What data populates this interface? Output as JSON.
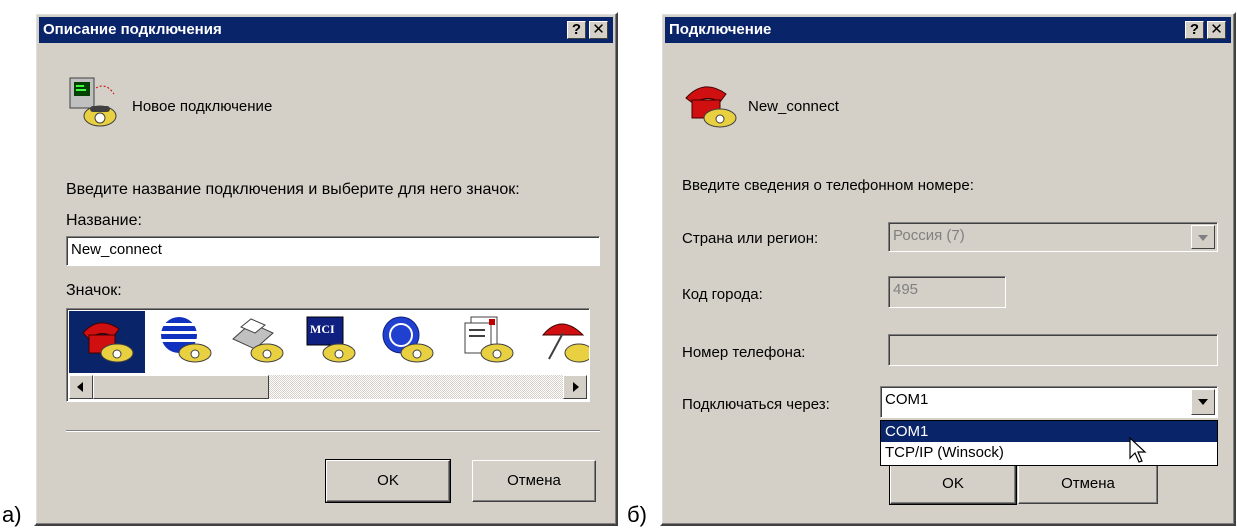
{
  "labels": {
    "a": "а)",
    "b": "б)"
  },
  "dialog_a": {
    "title": "Описание подключения",
    "help_btn": "?",
    "close_btn": "✕",
    "heading": "Новое подключение",
    "prompt": "Введите название подключения и выберите для него значок:",
    "name_label": "Название:",
    "name_value": "New_connect",
    "icon_label": "Значок:",
    "icons": [
      "red-phone-icon",
      "globe-phone-icon",
      "fax-phone-icon",
      "mci-phone-icon",
      "ge-phone-icon",
      "document-phone-icon",
      "umbrella-phone-icon"
    ],
    "ok": "OK",
    "cancel": "Отмена"
  },
  "dialog_b": {
    "title": "Подключение",
    "help_btn": "?",
    "close_btn": "✕",
    "heading": "New_connect",
    "prompt": "Введите сведения о телефонном номере:",
    "country_label": "Страна или регион:",
    "country_value": "Россия (7)",
    "area_label": "Код города:",
    "area_value": "495",
    "phone_label": "Номер телефона:",
    "phone_value": "",
    "connect_label": "Подключаться через:",
    "connect_value": "COM1",
    "connect_options": [
      "COM1",
      "TCP/IP (Winsock)"
    ],
    "ok": "OK",
    "cancel": "Отмена"
  },
  "colors": {
    "titlebar": "#0a246a",
    "face": "#d4d0c8",
    "selection": "#0a246a"
  }
}
